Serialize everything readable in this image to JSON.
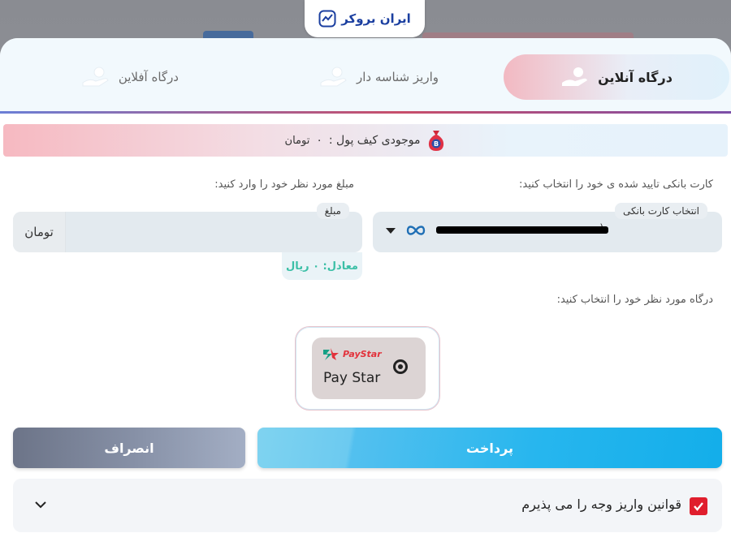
{
  "brand": {
    "name": "ایران بروکر"
  },
  "tabs": [
    {
      "label": "درگاه آنلاین",
      "active": true,
      "icon": "hand-coin-icon"
    },
    {
      "label": "واریز شناسه دار",
      "active": false,
      "icon": "hand-coin-icon"
    },
    {
      "label": "درگاه آفلاین",
      "active": false,
      "icon": "hand-coin-icon"
    }
  ],
  "wallet": {
    "label": "موجودی کیف پول :",
    "amount": "۰",
    "unit": "تومان",
    "icon": "money-bag-icon"
  },
  "card": {
    "prompt": "کارت بانکی تایید شده ی خود را انتخاب کنید:",
    "legend": "انتخاب کارت بانکی",
    "value_masked": "(",
    "icon": "infinity-icon"
  },
  "amount": {
    "prompt": "مبلغ مورد نظر خود را وارد کنید:",
    "legend": "مبلغ",
    "value": "",
    "unit": "تومان",
    "equivalent": "معادل: ۰ ریال"
  },
  "gateway": {
    "prompt": "درگاه مورد نظر خود را انتخاب کنید:",
    "options": [
      {
        "logo_text": "PayStar",
        "name": "Pay Star",
        "selected": true
      }
    ]
  },
  "actions": {
    "pay": "پرداخت",
    "cancel": "انصراف"
  },
  "terms": {
    "label": "قوانین واریز وجه را می پذیرم",
    "checked": true
  },
  "colors": {
    "accent": "#13aeea",
    "brand": "#1b3fa0",
    "danger": "#e01e2d",
    "equiv": "#3bbfa6"
  }
}
